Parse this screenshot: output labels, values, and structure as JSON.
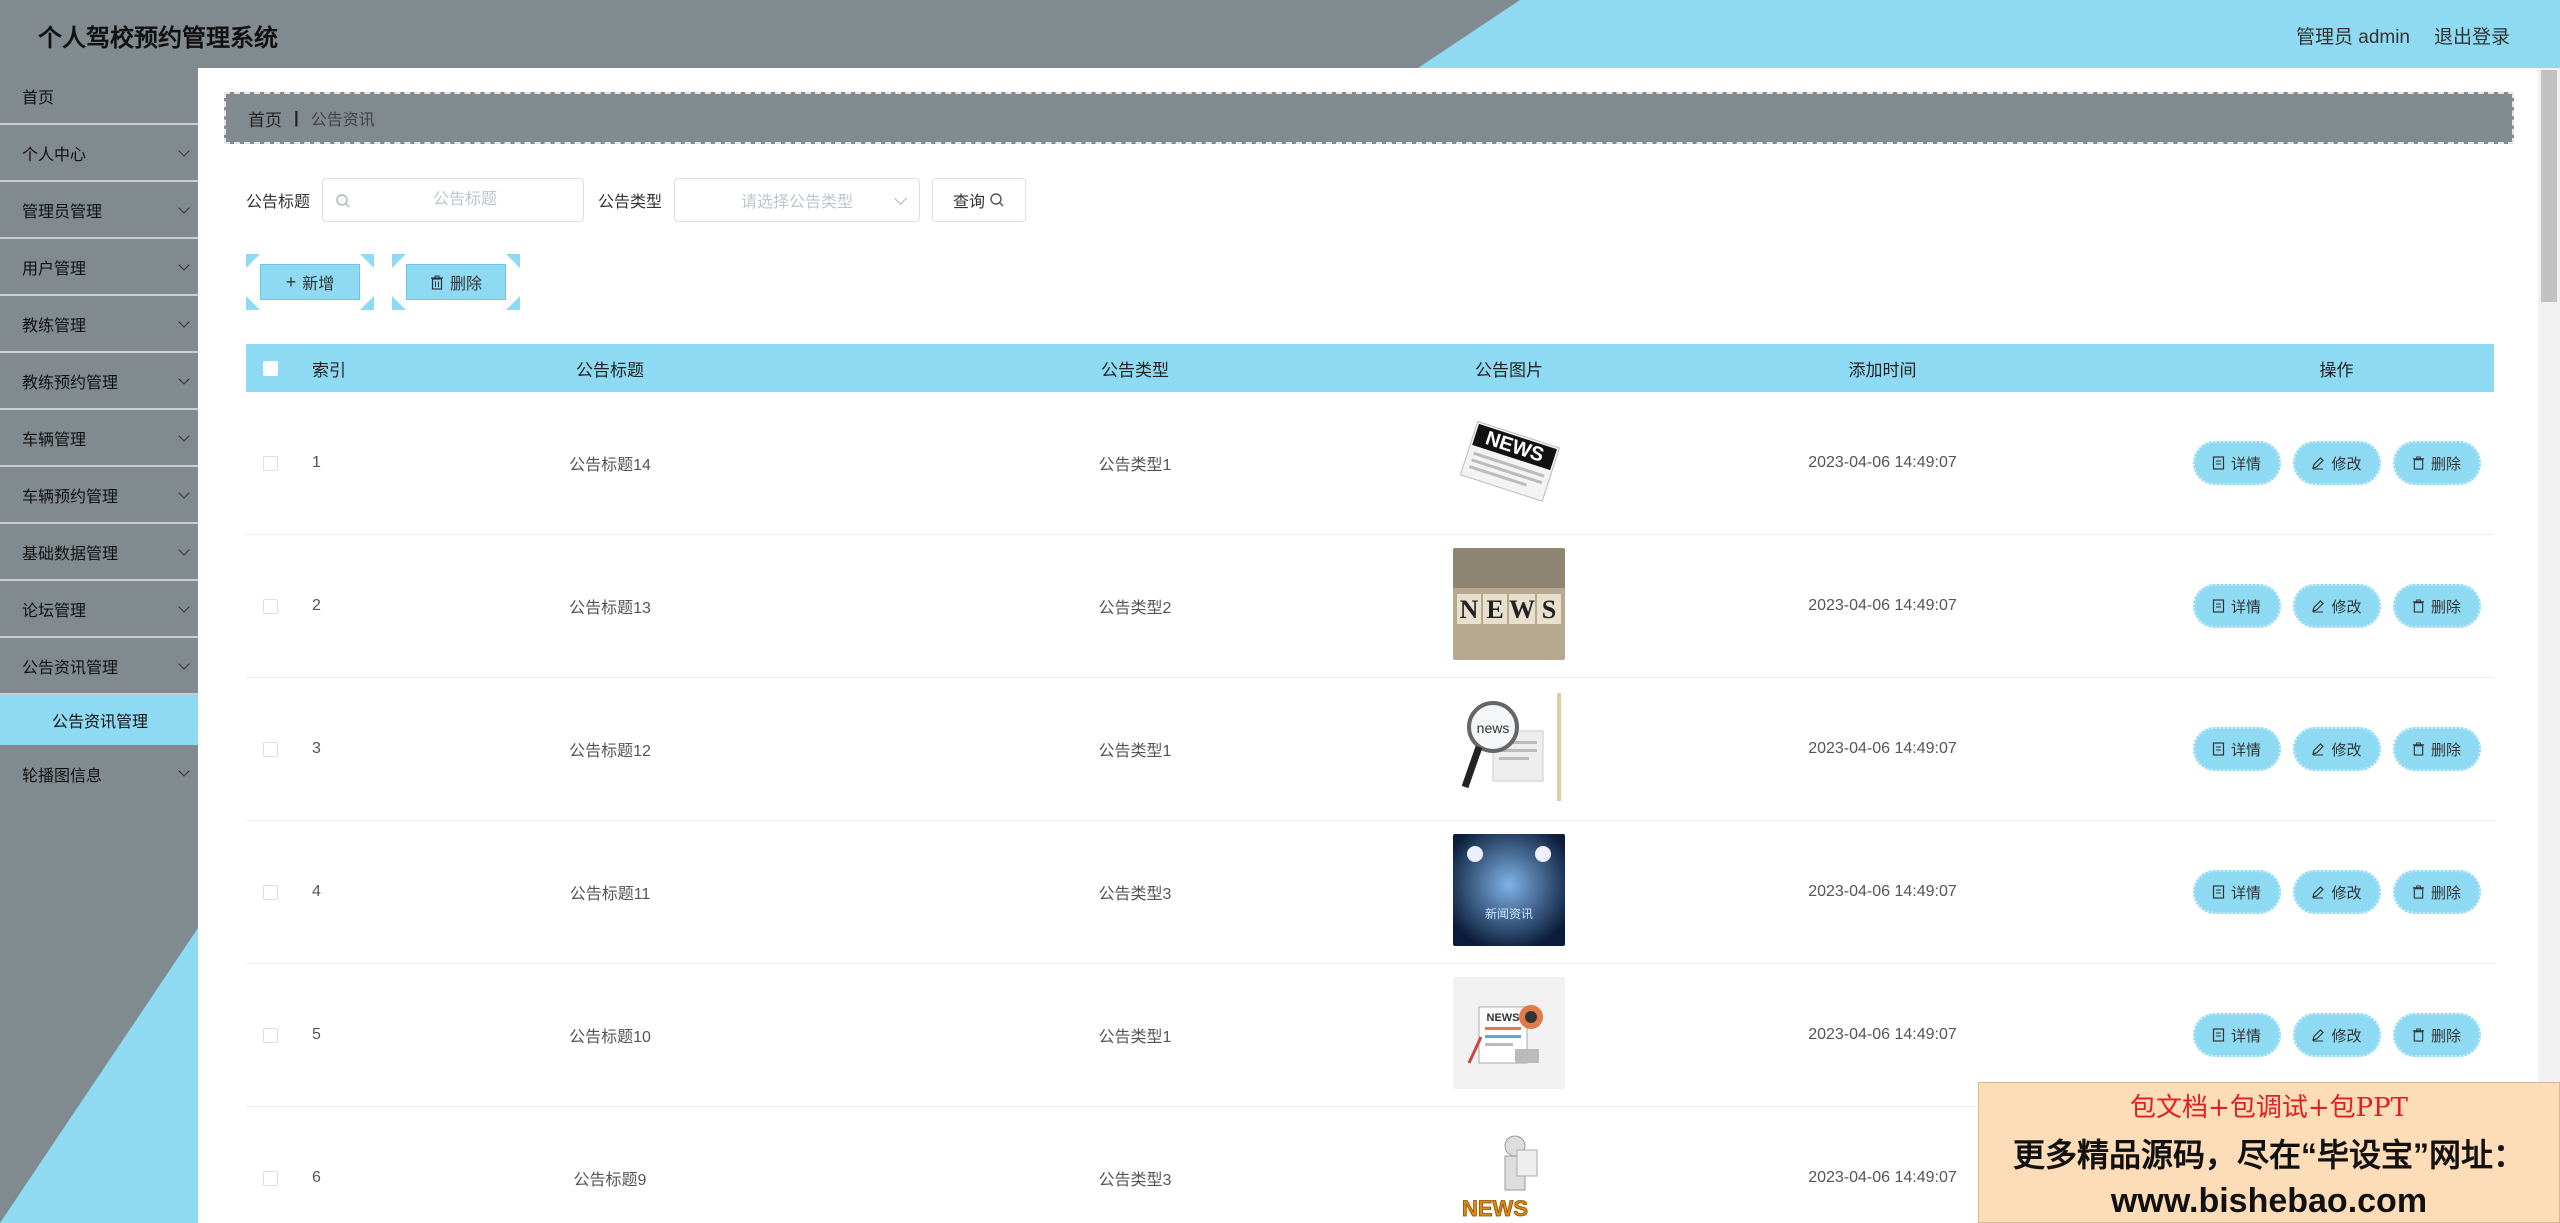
{
  "header": {
    "title": "个人驾校预约管理系统",
    "user": "管理员 admin",
    "logout": "退出登录"
  },
  "sidebar": {
    "items": [
      {
        "label": "首页",
        "chevron": false
      },
      {
        "label": "个人中心",
        "chevron": true
      },
      {
        "label": "管理员管理",
        "chevron": true
      },
      {
        "label": "用户管理",
        "chevron": true
      },
      {
        "label": "教练管理",
        "chevron": true
      },
      {
        "label": "教练预约管理",
        "chevron": true
      },
      {
        "label": "车辆管理",
        "chevron": true
      },
      {
        "label": "车辆预约管理",
        "chevron": true
      },
      {
        "label": "基础数据管理",
        "chevron": true
      },
      {
        "label": "论坛管理",
        "chevron": true
      },
      {
        "label": "公告资讯管理",
        "chevron": true
      }
    ],
    "active_sub": "公告资讯管理",
    "last_item": "轮播图信息"
  },
  "breadcrumb": {
    "home": "首页",
    "sep": "|",
    "current": "公告资讯"
  },
  "search": {
    "title_label": "公告标题",
    "title_placeholder": "公告标题",
    "type_label": "公告类型",
    "type_placeholder": "请选择公告类型",
    "query_label": "查询"
  },
  "actions": {
    "add_label": "新增",
    "delete_label": "删除"
  },
  "table": {
    "columns": {
      "index": "索引",
      "title": "公告标题",
      "type": "公告类型",
      "image": "公告图片",
      "time": "添加时间",
      "ops": "操作"
    },
    "op_labels": {
      "detail": "详情",
      "edit": "修改",
      "delete": "删除"
    },
    "rows": [
      {
        "index": "1",
        "title": "公告标题14",
        "type": "公告类型1",
        "image": "news-newspaper-image",
        "time": "2023-04-06 14:49:07"
      },
      {
        "index": "2",
        "title": "公告标题13",
        "type": "公告类型2",
        "image": "news-blocks-image",
        "time": "2023-04-06 14:49:07"
      },
      {
        "index": "3",
        "title": "公告标题12",
        "type": "公告类型1",
        "image": "news-magnifier-image",
        "time": "2023-04-06 14:49:07"
      },
      {
        "index": "4",
        "title": "公告标题11",
        "type": "公告类型3",
        "image": "news-stage-image",
        "time": "2023-04-06 14:49:07"
      },
      {
        "index": "5",
        "title": "公告标题10",
        "type": "公告类型1",
        "image": "news-illustration-image",
        "time": "2023-04-06 14:49:07"
      },
      {
        "index": "6",
        "title": "公告标题9",
        "type": "公告类型3",
        "image": "news-figure-image",
        "time": "2023-04-06 14:49:07"
      }
    ]
  },
  "thumb_text": {
    "stage": "新闻资讯"
  },
  "watermark": {
    "line1": "包文档+包调试+包PPT",
    "line2": "更多精品源码，尽在“毕设宝”网址：",
    "line3": "www.bishebao.com"
  },
  "colors": {
    "accent": "#8fdaf3",
    "gray": "#818a8e"
  }
}
